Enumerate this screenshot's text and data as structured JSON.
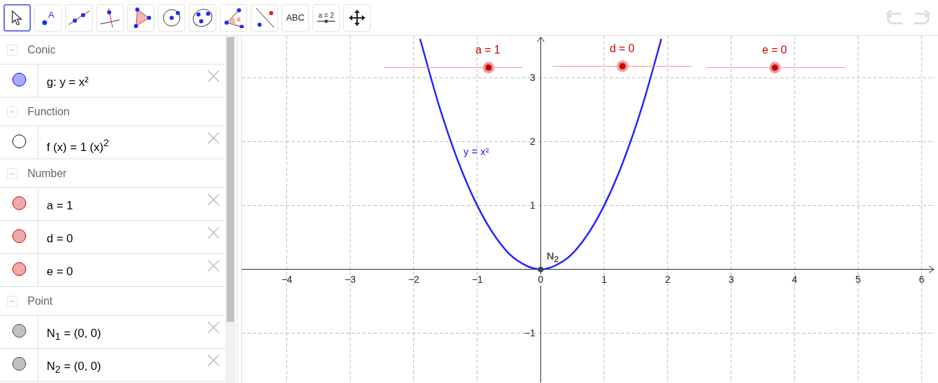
{
  "toolbar": {
    "tools": [
      {
        "kind": "move",
        "selected": true
      },
      {
        "kind": "point",
        "label": "A",
        "selected": false
      },
      {
        "kind": "line",
        "selected": false
      },
      {
        "kind": "perpendicular",
        "selected": false
      },
      {
        "kind": "polygon",
        "selected": false
      },
      {
        "kind": "circle",
        "selected": false
      },
      {
        "kind": "conic",
        "selected": false
      },
      {
        "kind": "angle",
        "label": "α",
        "selected": false
      },
      {
        "kind": "reflect",
        "selected": false
      },
      {
        "kind": "text",
        "label": "ABC",
        "selected": false
      },
      {
        "kind": "slider",
        "label": "a = 2",
        "selected": false
      },
      {
        "kind": "pan",
        "selected": false
      }
    ],
    "undo": {
      "disabled": true
    },
    "redo": {
      "disabled": true
    }
  },
  "algebra": {
    "groups": [
      {
        "title": "Conic",
        "expanded": true,
        "items": [
          {
            "text": "g: y = x²",
            "color": "#0000ff",
            "visible": true
          }
        ]
      },
      {
        "title": "Function",
        "expanded": true,
        "items": [
          {
            "text": "f (x) = 1 (x)$^{2}$",
            "color": "#000000",
            "visible": false
          }
        ]
      },
      {
        "title": "Number",
        "expanded": true,
        "items": [
          {
            "text": "a = 1",
            "color": "#cc0000",
            "visible": true
          },
          {
            "text": "d = 0",
            "color": "#cc0000",
            "visible": true
          },
          {
            "text": "e = 0",
            "color": "#cc0000",
            "visible": true
          }
        ]
      },
      {
        "title": "Point",
        "expanded": true,
        "items": [
          {
            "text": "N$_{1}$ = (0, 0)",
            "color": "#444444",
            "visible": true
          },
          {
            "text": "N$_{2}$ = (0, 0)",
            "color": "#444444",
            "visible": true
          }
        ]
      }
    ]
  },
  "graphics": {
    "sliders": [
      {
        "label": "a = 1",
        "level": 0.75
      },
      {
        "label": "d = 0",
        "level": 0.5
      },
      {
        "label": "e = 0",
        "level": 0.49
      }
    ],
    "point_label": "N$_{2}$",
    "chart_data": {
      "type": "line",
      "grid": true,
      "x": [
        -1.9,
        -1.6,
        -1.3,
        -1,
        -0.7,
        -0.4,
        0,
        0.4,
        0.7,
        1,
        1.3,
        1.6,
        1.9
      ],
      "series": [
        {
          "name": "y = x²",
          "color": "#2222ff",
          "values": [
            3.61,
            2.56,
            1.69,
            1,
            0.49,
            0.16,
            0,
            0.16,
            0.49,
            1,
            1.69,
            2.56,
            3.61
          ]
        }
      ],
      "xlim": [
        -4.71,
        6.215
      ],
      "ylim": [
        -1.77,
        3.66
      ],
      "xticks": [
        {
          "value": -4,
          "label": "−4"
        },
        {
          "value": -3,
          "label": "−3"
        },
        {
          "value": -2,
          "label": "−2"
        },
        {
          "value": -1,
          "label": "−1"
        },
        {
          "value": 0,
          "label": "0"
        },
        {
          "value": 1,
          "label": "1"
        },
        {
          "value": 2,
          "label": "2"
        },
        {
          "value": 3,
          "label": "3"
        },
        {
          "value": 4,
          "label": "4"
        },
        {
          "value": 5,
          "label": "5"
        },
        {
          "value": 6,
          "label": "6"
        }
      ],
      "yticks": [
        {
          "value": -1,
          "label": "−1"
        },
        {
          "value": 1,
          "label": "1"
        },
        {
          "value": 2,
          "label": "2"
        },
        {
          "value": 3,
          "label": "3"
        }
      ]
    }
  }
}
